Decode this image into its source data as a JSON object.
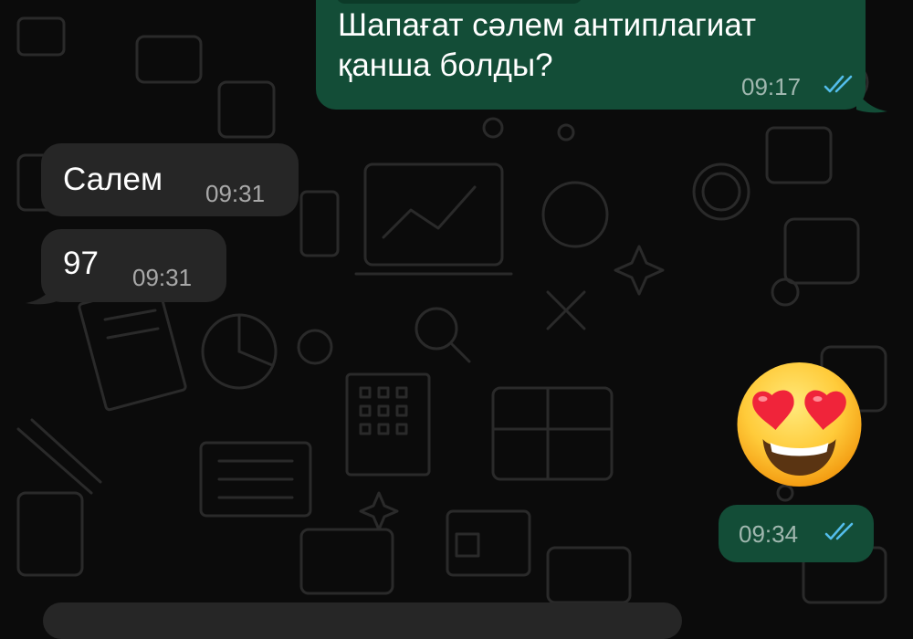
{
  "messages": [
    {
      "id": "m1",
      "direction": "outgoing",
      "lines": [
        "Шапағат сәлем антиплагиат",
        "қанша болды?"
      ],
      "time": "09:17",
      "status": "read"
    },
    {
      "id": "m2",
      "direction": "incoming",
      "text": "Салем",
      "time": "09:31"
    },
    {
      "id": "m3",
      "direction": "incoming",
      "text": "97",
      "time": "09:31"
    },
    {
      "id": "m4",
      "direction": "outgoing",
      "emoji": "smiling-face-with-heart-eyes",
      "time": "09:34",
      "status": "read"
    }
  ],
  "colors": {
    "background": "#0b0b0b",
    "outgoing_bubble": "#134d37",
    "incoming_bubble": "#262626",
    "read_ticks": "#53bdeb",
    "time_text": "#9aa3a0"
  }
}
